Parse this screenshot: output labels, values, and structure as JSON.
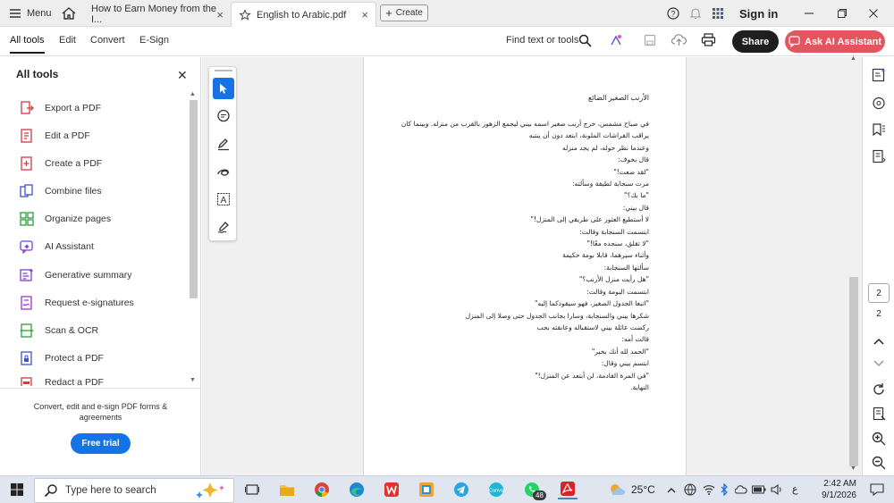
{
  "titlebar": {
    "menu_label": "Menu",
    "tabs": [
      {
        "label": "How to Earn Money from the I..."
      },
      {
        "label": "English to Arabic.pdf"
      }
    ],
    "create_label": "Create",
    "signin_label": "Sign in"
  },
  "menubar": {
    "items": [
      "All tools",
      "Edit",
      "Convert",
      "E-Sign"
    ],
    "find_label": "Find text or tools",
    "share_label": "Share",
    "ai_label": "Ask AI Assistant"
  },
  "left_panel": {
    "title": "All tools",
    "tools": [
      {
        "label": "Export a PDF",
        "icon": "export-pdf-icon",
        "color": "#d7373f"
      },
      {
        "label": "Edit a PDF",
        "icon": "edit-pdf-icon",
        "color": "#d7373f"
      },
      {
        "label": "Create a PDF",
        "icon": "create-pdf-icon",
        "color": "#d7373f"
      },
      {
        "label": "Combine files",
        "icon": "combine-files-icon",
        "color": "#3f51d6"
      },
      {
        "label": "Organize pages",
        "icon": "organize-pages-icon",
        "color": "#2d9d3a"
      },
      {
        "label": "AI Assistant",
        "icon": "ai-assistant-icon",
        "color": "#7b3fd6"
      },
      {
        "label": "Generative summary",
        "icon": "generative-summary-icon",
        "color": "#7b3fd6"
      },
      {
        "label": "Request e-signatures",
        "icon": "request-esignature-icon",
        "color": "#9b36c9"
      },
      {
        "label": "Scan & OCR",
        "icon": "scan-ocr-icon",
        "color": "#2d9d3a"
      },
      {
        "label": "Protect a PDF",
        "icon": "protect-pdf-icon",
        "color": "#3f51d6"
      },
      {
        "label": "Redact a PDF",
        "icon": "redact-pdf-icon",
        "color": "#d7373f"
      }
    ],
    "promo_text": "Convert, edit and e-sign PDF forms & agreements",
    "trial_label": "Free trial"
  },
  "document": {
    "title": "الأرنب الصغير الضائع",
    "lines": [
      "في صباح مشمس، خرج أرنب صغير اسمه بيني ليجمع الزهور بالقرب من منزله. وبينما كان",
      "يراقب الفراشات الملونة، ابتعد دون أن ينتبه",
      "وعندما نظر حوله، لم يجد منزله",
      "قال بخوف:",
      "\"لقد ضعت!\"",
      "مرت سنجابة لطيفة وسألته:",
      "\"ما بك؟\"",
      "قال بيني:",
      "لا أستطيع العثور على طريقي إلى المنزل!\"",
      "ابتسمت السنجابة وقالت:",
      "\"لا تقلق، سنجده معًا!\"",
      "وأثناء سيرهما، قابلا بومة حكيمة",
      "سألتها السنجابة:",
      "\"هل رأيت منزل الأرنب؟\"",
      "ابتسمت البومة وقالت:",
      "\"اتبعا الجدول الصغير، فهو سيقودكما إليه\"",
      "شكرها بيني والسنجابة، وسارا بجانب الجدول حتى وصلا إلى المنزل",
      "ركضت عائلة بيني لاستقباله وعانقته بحب",
      "قالت أمه:",
      "\"الحمد لله أنك بخير\"",
      "ابتسم بيني وقال:",
      "\"في المرة القادمة، لن أبتعد عن المنزل!\"",
      "النهاية."
    ]
  },
  "right_rail": {
    "page_current": "2",
    "page_total": "2"
  },
  "taskbar": {
    "search_placeholder": "Type here to search",
    "weather": "25°C",
    "lang": "ع",
    "time": "2:42 AM",
    "date": "9/1/2026",
    "whatsapp_badge": "48"
  },
  "colors": {
    "accent": "#1473e6",
    "ai_button": "#e5555f",
    "share_button": "#1f1f1f"
  }
}
